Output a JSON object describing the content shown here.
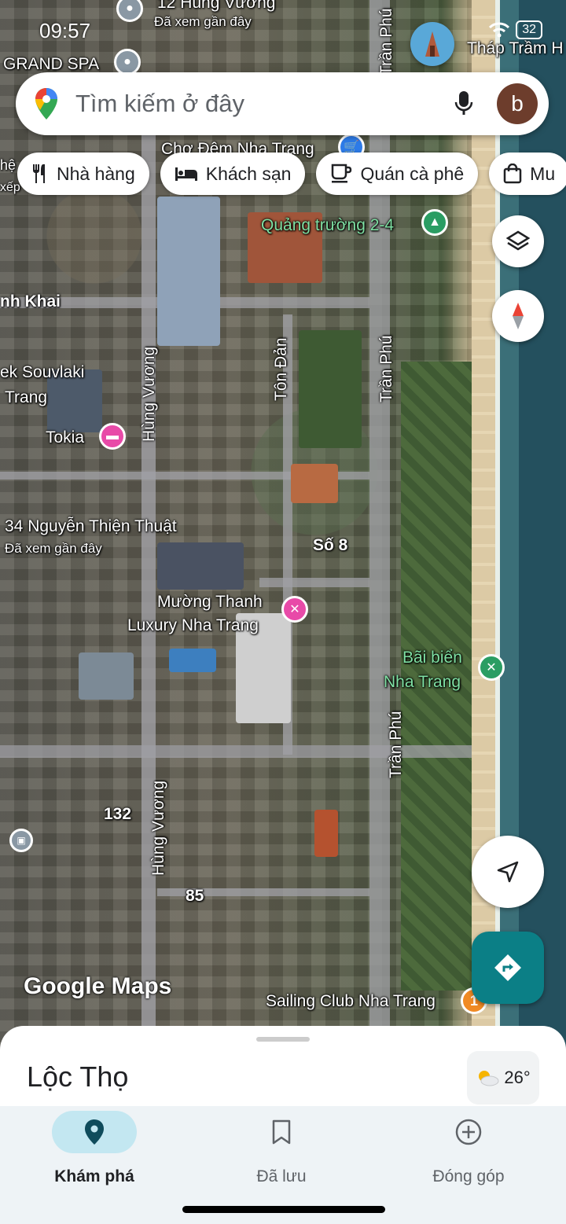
{
  "status": {
    "time": "09:57",
    "battery": "32"
  },
  "search": {
    "placeholder": "Tìm kiếm ở đây",
    "avatar_letter": "b"
  },
  "chips": [
    {
      "label": "Nhà hàng",
      "icon": "fork-knife-icon"
    },
    {
      "label": "Khách sạn",
      "icon": "bed-icon"
    },
    {
      "label": "Quán cà phê",
      "icon": "coffee-cup-icon"
    },
    {
      "label": "Mu",
      "icon": "shopping-bag-icon"
    }
  ],
  "map": {
    "labels": {
      "hung_vuong_12": "12 Hùng Vương",
      "recent_1": "Đã xem gần đây",
      "grand_spa": "GRAND SPA",
      "thap_tram": "Tháp Trầm H",
      "cho_dem": "Chợ Đêm Nha Trang",
      "quang_truong": "Quảng trường 2-4",
      "nh_khai": "nh Khai",
      "souvlaki_1": "ek Souvlaki",
      "souvlaki_2": "Trang",
      "tokia": "Tokia",
      "nguyen_thien_thuat": "34 Nguyễn Thiện Thuật",
      "recent_2": "Đã xem gần đây",
      "so8": "Số 8",
      "muong_thanh_1": "Mường Thanh",
      "muong_thanh_2": "Luxury Nha Trang",
      "bai_bien_1": "Bãi biển",
      "bai_bien_2": "Nha Trang",
      "num_132": "132",
      "num_85": "85",
      "sailing": "Sailing Club Nha Trang",
      "left_clip_1": "hệ",
      "left_clip_2": "xếp",
      "street_hung_vuong_1": "Hùng Vương",
      "street_hung_vuong_2": "Hùng Vương",
      "street_ton_dan": "Tôn Đản",
      "street_tran_phu_1": "Trần Phú",
      "street_tran_phu_2": "Trần Phú",
      "street_tran_phu_3": "Trần Phú",
      "sailing_badge": "1"
    },
    "logo": "Google Maps"
  },
  "sheet": {
    "area_name": "Lộc Thọ",
    "temperature": "26°"
  },
  "nav": [
    {
      "label": "Khám phá",
      "icon": "explore-pin-icon",
      "active": true
    },
    {
      "label": "Đã lưu",
      "icon": "bookmark-icon",
      "active": false
    },
    {
      "label": "Đóng góp",
      "icon": "add-circle-icon",
      "active": false
    }
  ],
  "colors": {
    "accent": "#0b7f86",
    "nav_active": "#c3e7f1",
    "pink_pin": "#e84aa8",
    "green_pin": "#2a9d63"
  }
}
